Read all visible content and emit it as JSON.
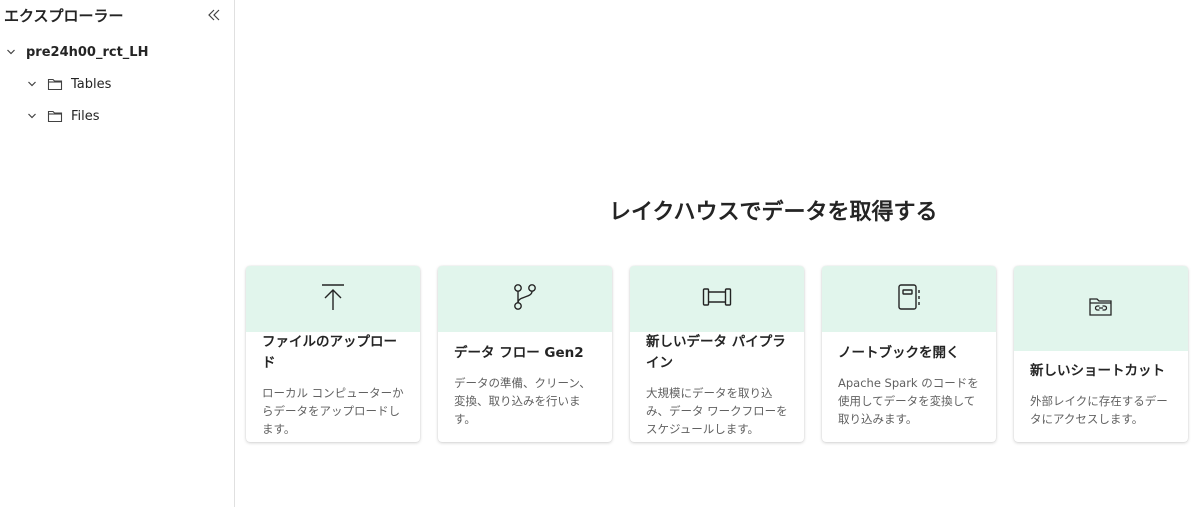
{
  "sidebar": {
    "title": "エクスプローラー",
    "collapse_icon": "double-chevron-left-icon",
    "tree": {
      "root_label": "pre24h00_rct_LH",
      "children": [
        {
          "label": "Tables",
          "icon": "folder-icon"
        },
        {
          "label": "Files",
          "icon": "folder-icon"
        }
      ]
    }
  },
  "main": {
    "title": "レイクハウスでデータを取得する",
    "accent_color": "#e1f5ec",
    "cards": [
      {
        "icon": "upload-icon",
        "title": "ファイルのアップロード",
        "description": "ローカル コンピューターからデータをアップロードします。"
      },
      {
        "icon": "branch-icon",
        "title": "データ フロー Gen2",
        "description": "データの準備、クリーン、変換、取り込みを行います。"
      },
      {
        "icon": "pipeline-icon",
        "title": "新しいデータ パイプライン",
        "description": "大規模にデータを取り込み、データ ワークフローをスケジュールします。"
      },
      {
        "icon": "notebook-icon",
        "title": "ノートブックを開く",
        "description": "Apache Spark のコードを使用してデータを変換して取り込みます。"
      },
      {
        "icon": "shortcut-folder-icon",
        "title": "新しいショートカット",
        "description": "外部レイクに存在するデータにアクセスします。"
      }
    ]
  }
}
